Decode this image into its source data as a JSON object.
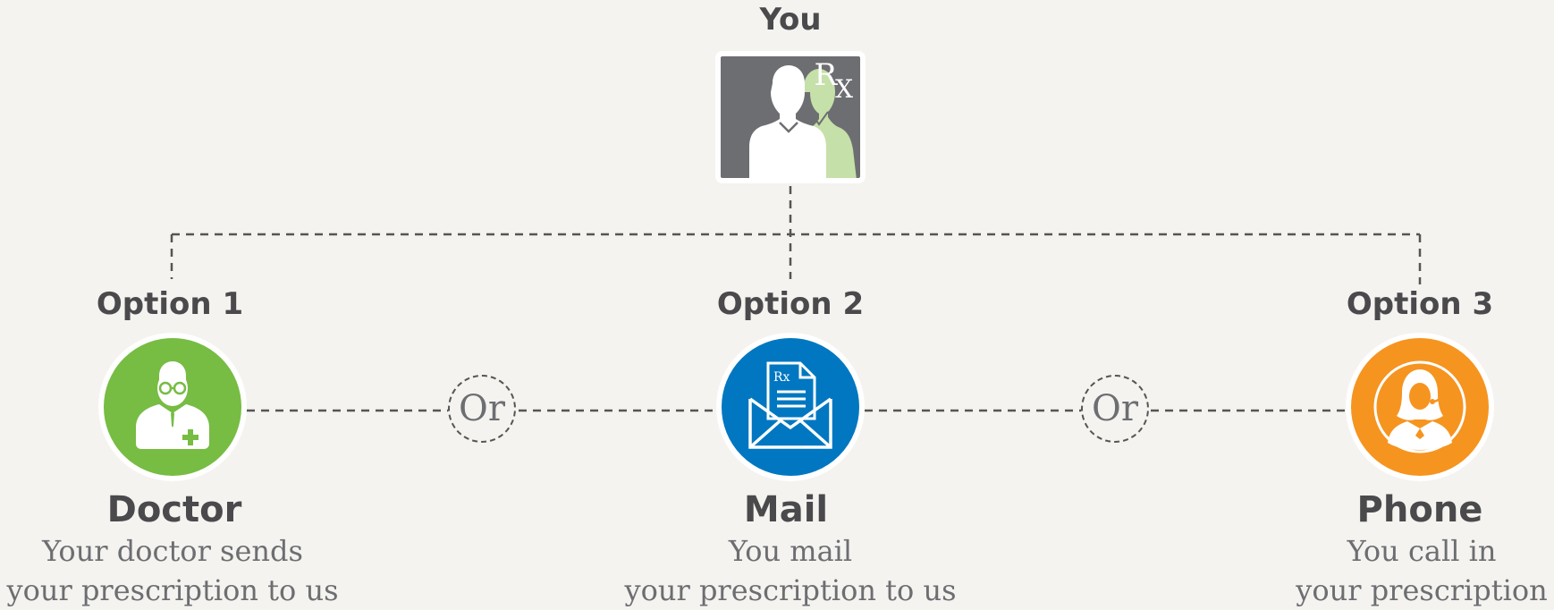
{
  "top": {
    "label": "You",
    "rx_r": "R",
    "rx_x": "X"
  },
  "options": [
    {
      "title": "Option 1",
      "name": "Doctor",
      "desc_line1": "Your doctor sends",
      "desc_line2": "your prescription to us",
      "color": "#77bc43",
      "icon": "doctor-icon"
    },
    {
      "title": "Option 2",
      "name": "Mail",
      "desc_line1": "You mail",
      "desc_line2": "your prescription to us",
      "color": "#0177c1",
      "icon": "mail-icon"
    },
    {
      "title": "Option 3",
      "name": "Phone",
      "desc_line1": "You call in",
      "desc_line2": "your prescription",
      "color": "#f69420",
      "icon": "phone-operator-icon"
    }
  ],
  "separators": {
    "or_1": "Or",
    "or_2": "Or"
  },
  "mail_icon_rx": "Rx"
}
